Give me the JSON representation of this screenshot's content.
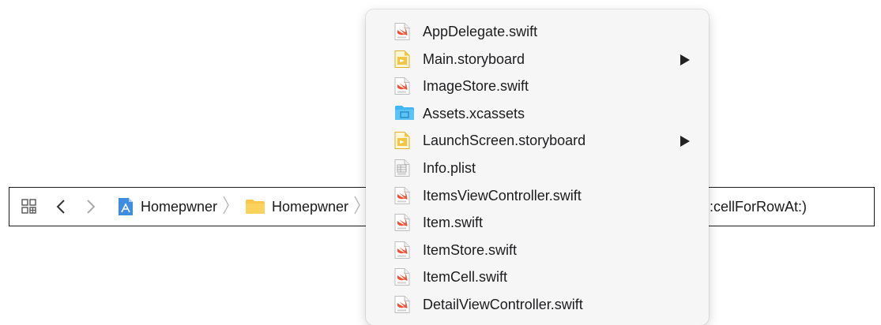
{
  "jumpbar": {
    "related_items_icon": "related-items-grid-icon",
    "back_icon": "chevron-left-icon",
    "forward_icon": "chevron-right-icon",
    "breadcrumb": [
      {
        "label": "Homepwner",
        "icon": "xcode-project-icon"
      },
      {
        "label": "Homepwner",
        "icon": "folder-icon"
      },
      {
        "label": ":cellForRowAt:)",
        "icon": "method-icon"
      }
    ]
  },
  "menu": {
    "items": [
      {
        "label": "AppDelegate.swift",
        "icon": "swift-file-icon",
        "has_submenu": false
      },
      {
        "label": "Main.storyboard",
        "icon": "storyboard-file-icon",
        "has_submenu": true
      },
      {
        "label": "ImageStore.swift",
        "icon": "swift-file-icon",
        "has_submenu": false
      },
      {
        "label": "Assets.xcassets",
        "icon": "asset-catalog-icon",
        "has_submenu": false
      },
      {
        "label": "LaunchScreen.storyboard",
        "icon": "storyboard-file-icon",
        "has_submenu": true
      },
      {
        "label": "Info.plist",
        "icon": "plist-file-icon",
        "has_submenu": false
      },
      {
        "label": "ItemsViewController.swift",
        "icon": "swift-file-icon",
        "has_submenu": false
      },
      {
        "label": "Item.swift",
        "icon": "swift-file-icon",
        "has_submenu": false
      },
      {
        "label": "ItemStore.swift",
        "icon": "swift-file-icon",
        "has_submenu": false
      },
      {
        "label": "ItemCell.swift",
        "icon": "swift-file-icon",
        "has_submenu": false
      },
      {
        "label": "DetailViewController.swift",
        "icon": "swift-file-icon",
        "has_submenu": false
      }
    ]
  },
  "colors": {
    "swift_orange": "#f05138",
    "folder_yellow": "#f9c84a",
    "assets_blue": "#41b6f2",
    "storyboard_yellow": "#f4c542",
    "project_blue": "#3e8ddf"
  }
}
